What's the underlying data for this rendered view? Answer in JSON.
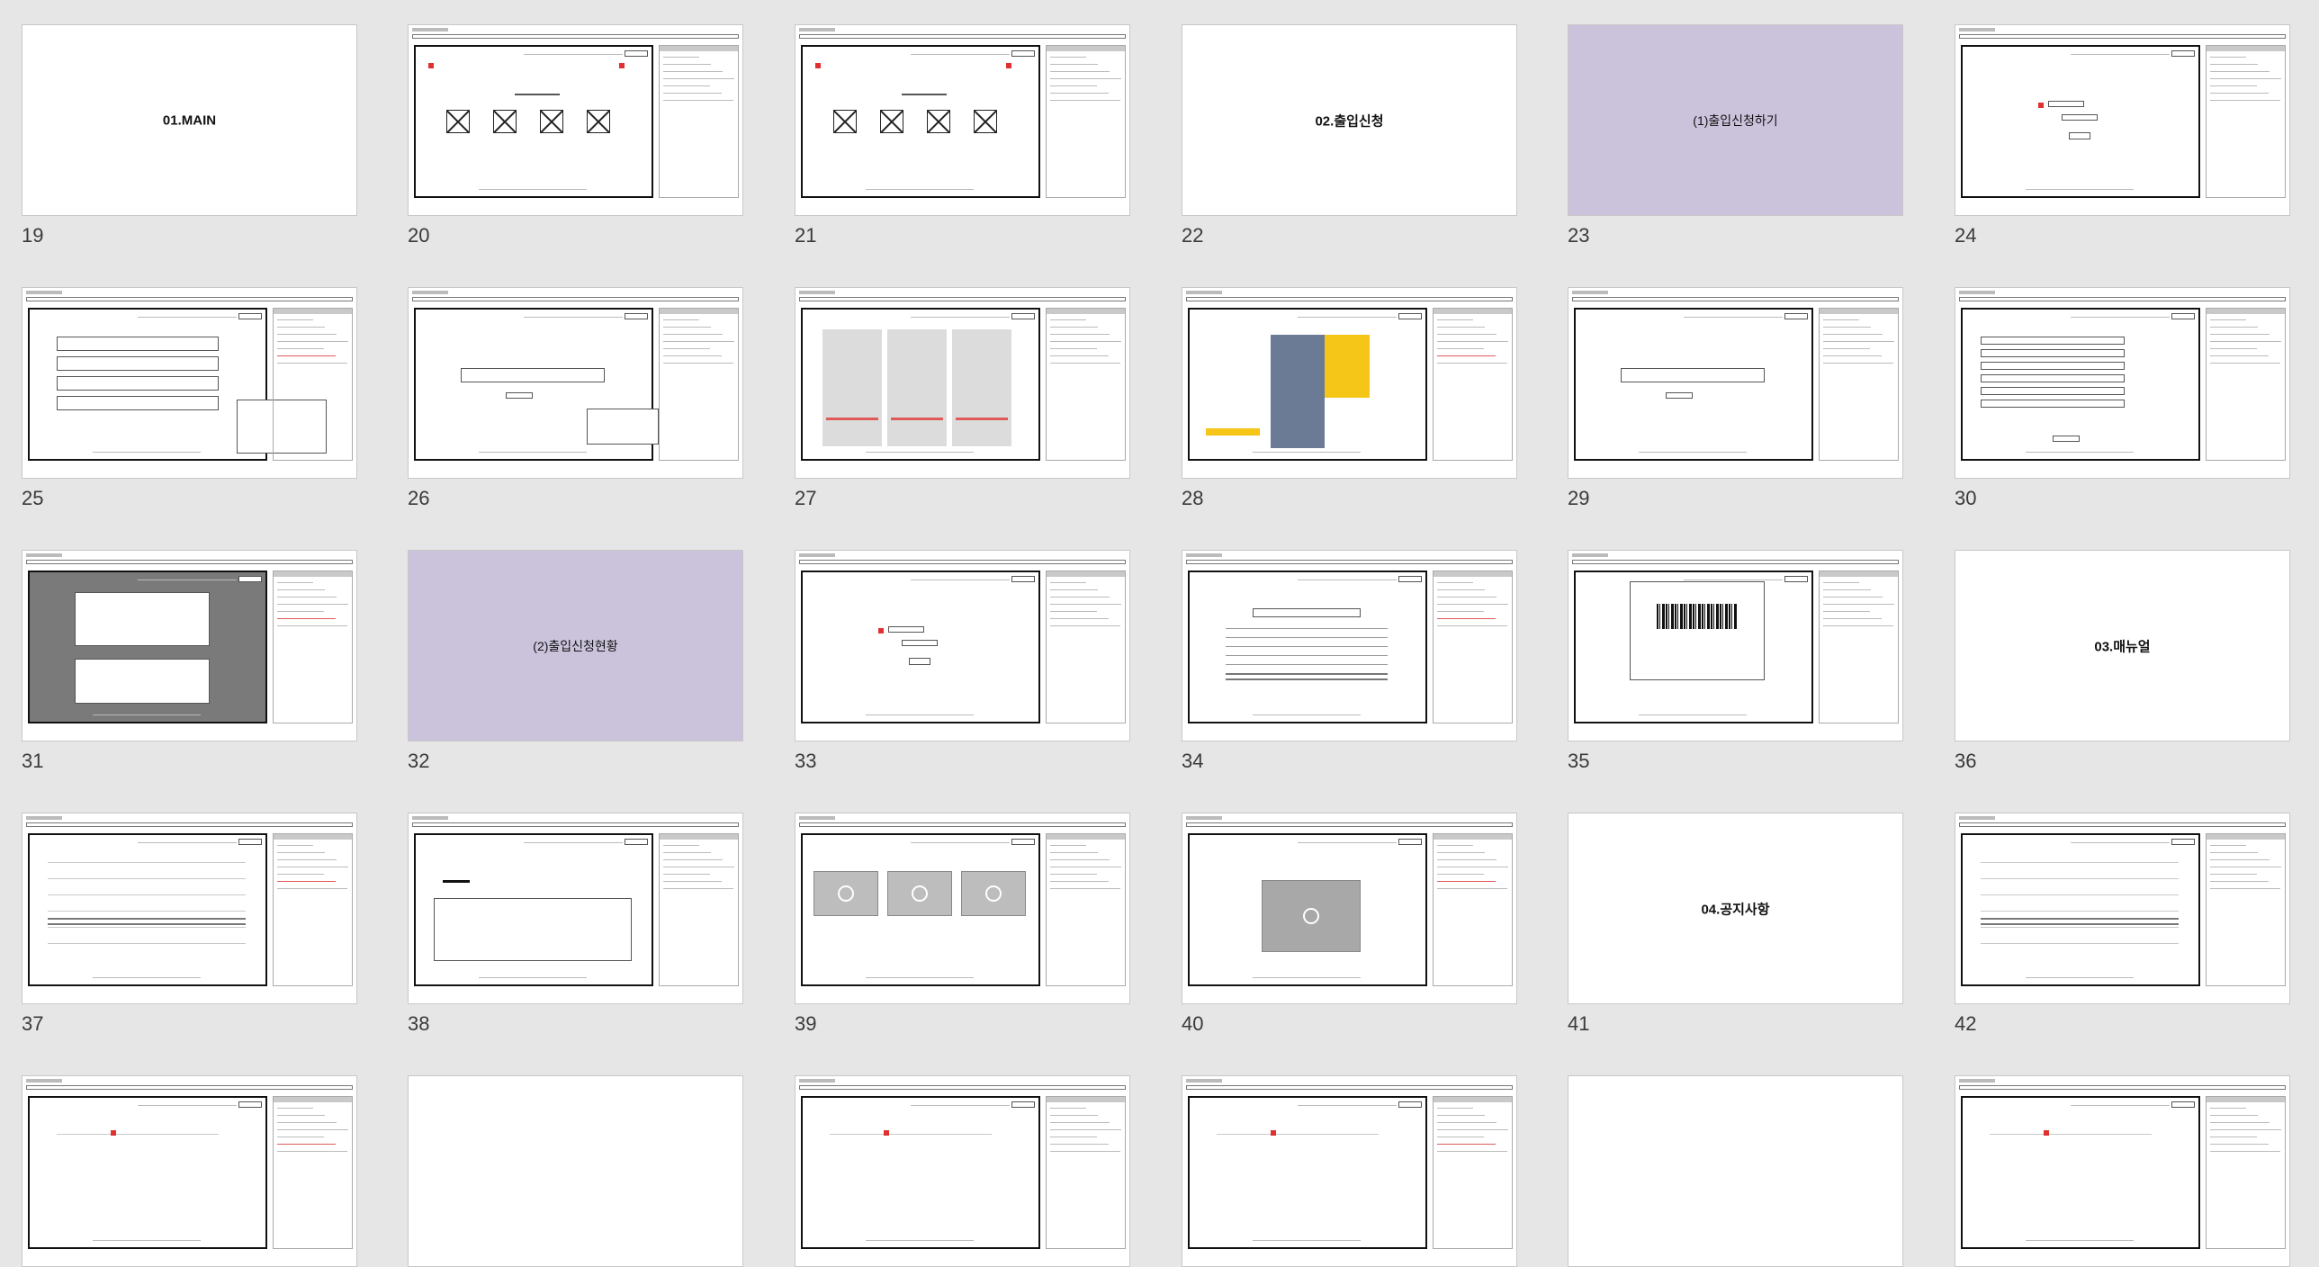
{
  "slides": [
    {
      "number": "19",
      "title": "01.MAIN",
      "kind": "section"
    },
    {
      "number": "20",
      "title": "",
      "kind": "wireframe"
    },
    {
      "number": "21",
      "title": "",
      "kind": "wireframe"
    },
    {
      "number": "22",
      "title": "02.출입신청",
      "kind": "section"
    },
    {
      "number": "23",
      "title": "(1)출입신청하기",
      "kind": "subsection"
    },
    {
      "number": "24",
      "title": "",
      "kind": "wireframe"
    },
    {
      "number": "25",
      "title": "",
      "kind": "wireframe"
    },
    {
      "number": "26",
      "title": "",
      "kind": "wireframe"
    },
    {
      "number": "27",
      "title": "",
      "kind": "wireframe"
    },
    {
      "number": "28",
      "title": "",
      "kind": "wireframe"
    },
    {
      "number": "29",
      "title": "",
      "kind": "wireframe"
    },
    {
      "number": "30",
      "title": "",
      "kind": "wireframe"
    },
    {
      "number": "31",
      "title": "",
      "kind": "wireframe"
    },
    {
      "number": "32",
      "title": "(2)출입신청현황",
      "kind": "subsection"
    },
    {
      "number": "33",
      "title": "",
      "kind": "wireframe"
    },
    {
      "number": "34",
      "title": "",
      "kind": "wireframe"
    },
    {
      "number": "35",
      "title": "",
      "kind": "wireframe"
    },
    {
      "number": "36",
      "title": "03.매뉴얼",
      "kind": "section"
    },
    {
      "number": "37",
      "title": "",
      "kind": "wireframe"
    },
    {
      "number": "38",
      "title": "",
      "kind": "wireframe"
    },
    {
      "number": "39",
      "title": "",
      "kind": "wireframe"
    },
    {
      "number": "40",
      "title": "",
      "kind": "wireframe"
    },
    {
      "number": "41",
      "title": "04.공지사항",
      "kind": "section"
    },
    {
      "number": "42",
      "title": "",
      "kind": "wireframe"
    },
    {
      "number": "",
      "title": "",
      "kind": "wireframe"
    },
    {
      "number": "",
      "title": "",
      "kind": "blank"
    },
    {
      "number": "",
      "title": "",
      "kind": "wireframe"
    },
    {
      "number": "",
      "title": "",
      "kind": "wireframe"
    },
    {
      "number": "",
      "title": "",
      "kind": "blank"
    },
    {
      "number": "",
      "title": "",
      "kind": "wireframe"
    }
  ],
  "colors": {
    "background": "#e6e6e6",
    "slide": "#ffffff",
    "subsection": "#cbc3dc",
    "accent_red": "#e03030",
    "accent_yellow": "#f5c518"
  }
}
